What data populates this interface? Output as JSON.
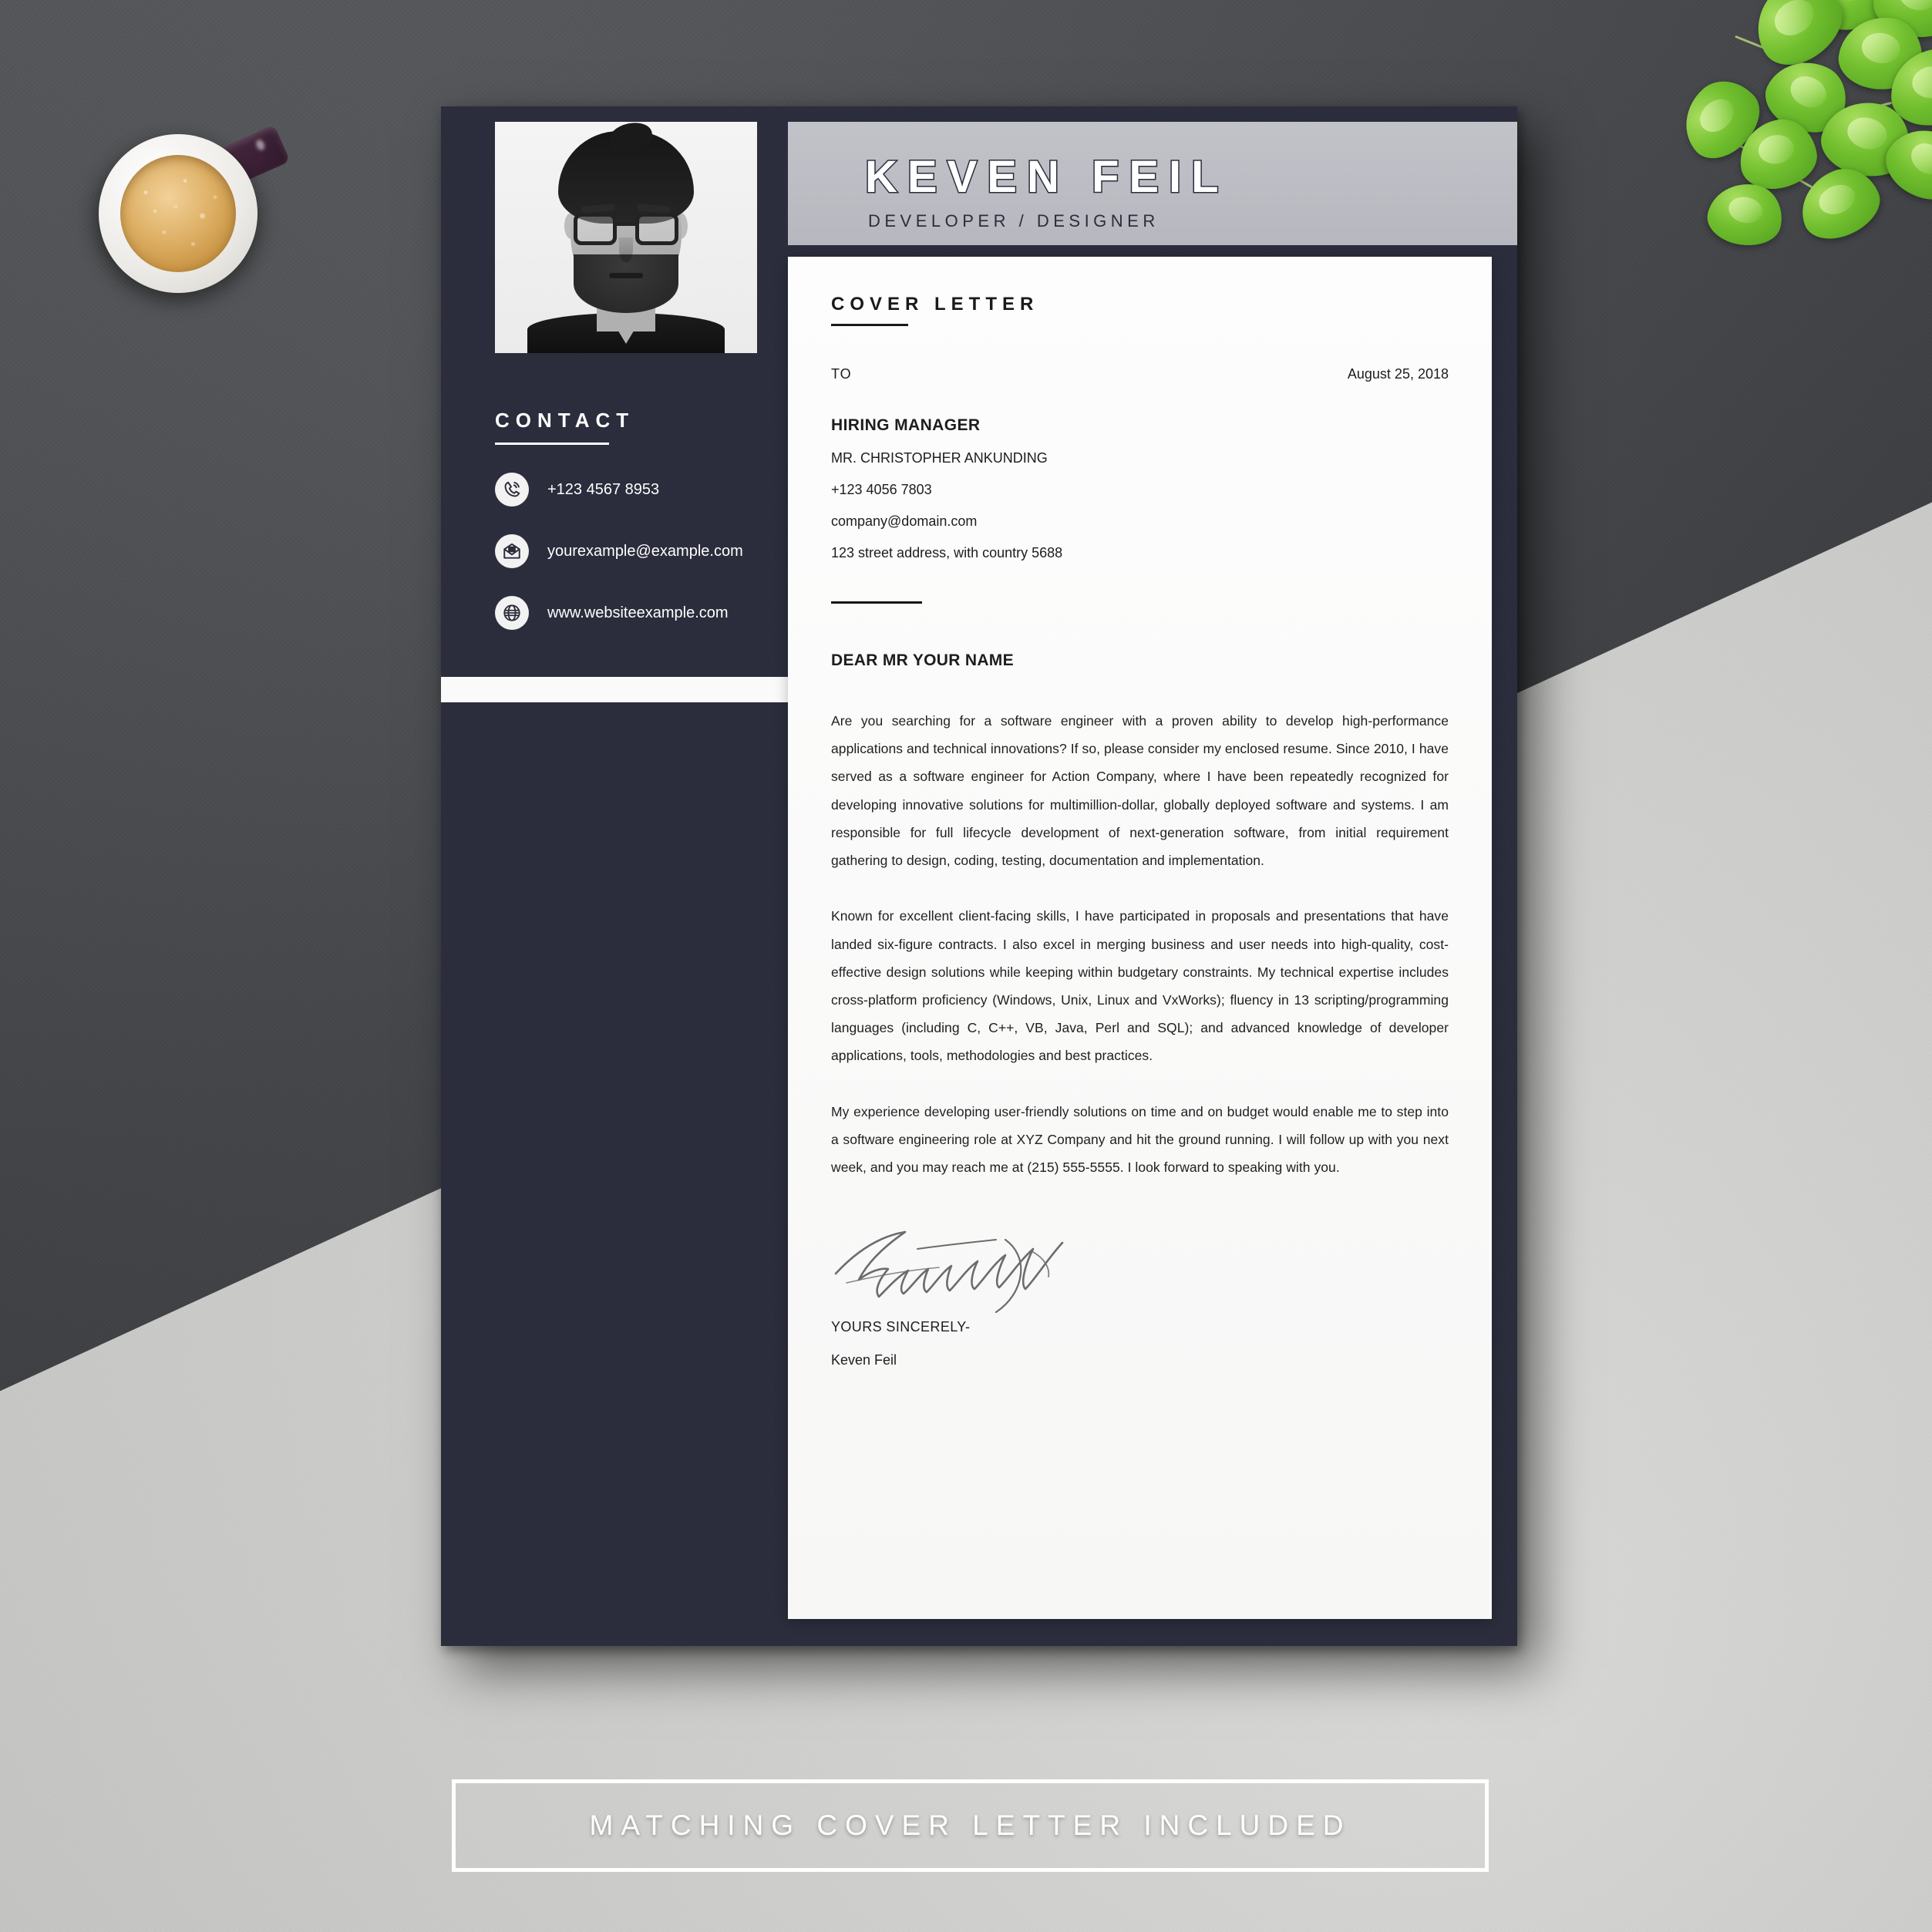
{
  "resume": {
    "photo_alt": "portrait-photo",
    "header": {
      "name": "KEVEN FEIL",
      "subtitle": "DEVELOPER / DESIGNER"
    },
    "contact": {
      "title": "CONTACT",
      "items": [
        {
          "icon": "phone-icon",
          "value": "+123 4567 8953"
        },
        {
          "icon": "envelope-icon",
          "value": "yourexample@example.com"
        },
        {
          "icon": "globe-icon",
          "value": "www.websiteexample.com"
        }
      ]
    }
  },
  "letter": {
    "title": "COVER LETTER",
    "to_label": "TO",
    "date": "August 25, 2018",
    "recipient": {
      "role": "HIRING MANAGER",
      "name": "MR. CHRISTOPHER ANKUNDING",
      "phone": "+123 4056 7803",
      "email": "company@domain.com",
      "address": "123 street address, with country 5688"
    },
    "salutation": "DEAR MR YOUR NAME",
    "paragraphs": [
      "Are you searching for a software engineer with a proven ability to develop high-performance applications and technical innovations? If so, please consider my enclosed resume. Since 2010, I have served as a software engineer for Action Company, where I have been repeatedly recognized for developing innovative solutions for multimillion-dollar, globally deployed software and systems. I am responsible for full lifecycle development of next-generation software, from initial requirement gathering to design, coding, testing, documentation and implementation.",
      "Known for excellent client-facing skills, I have participated in proposals and presentations that have landed six-figure contracts. I also excel in merging business and user needs into high-quality, cost-effective design solutions while keeping within budgetary constraints. My technical expertise includes cross-platform proficiency (Windows, Unix, Linux and VxWorks); fluency in 13 scripting/programming languages (including C, C++, VB, Java, Perl and SQL); and advanced knowledge of developer applications, tools, methodologies and best practices.",
      "My experience developing user-friendly solutions on time and on budget would enable me to step into a software engineering role at XYZ Company and hit the ground running. I will follow up with you next week, and you may reach me at (215) 555-5555. I look forward to speaking with you."
    ],
    "sign_off": "YOURS SINCERELY-",
    "sign_name": "Keven Feil",
    "signature_alt": "handwritten-signature"
  },
  "banner": {
    "text": "MATCHING COVER LETTER INCLUDED"
  },
  "props": {
    "coffee_cup": "coffee-cup",
    "plant": "pothos-plant"
  },
  "colors": {
    "card_navy": "#2b2d3c",
    "header_grey": "#bdbdc4",
    "sheet_white": "#fdfdfd",
    "accent_white": "#ffffff",
    "desk_dark": "#44464a",
    "desk_light": "#cfcfcd"
  }
}
